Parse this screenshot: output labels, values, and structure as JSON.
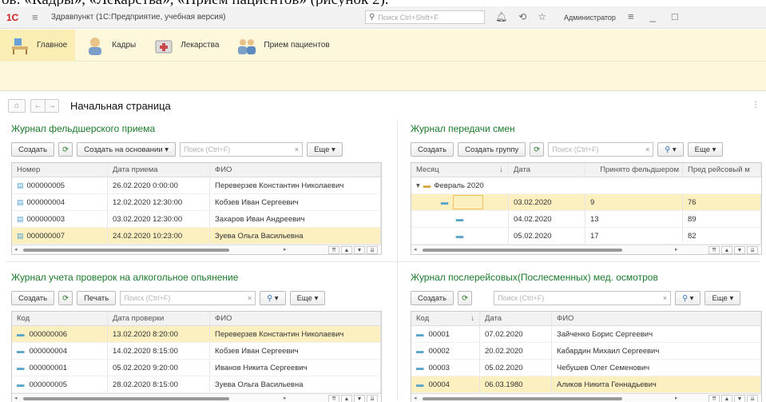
{
  "doc_caption": "ов: «Кадры», «Лекарства», «Прием пациентов» (рисунок 2).",
  "titlebar": {
    "logo": "1С",
    "title": "Здравпункт (1С:Предприятие, учебная версия)",
    "search_placeholder": "Поиск Ctrl+Shift+F",
    "user": "Администратор"
  },
  "sections": [
    {
      "label": "Главное",
      "icon": "desk-icon",
      "color": "#6aa0d8"
    },
    {
      "label": "Кадры",
      "icon": "staff-icon",
      "color": "#d9a35a"
    },
    {
      "label": "Лекарства",
      "icon": "medkit-icon",
      "color": "#c94a4a"
    },
    {
      "label": "Прием пациентов",
      "icon": "patients-icon",
      "color": "#7a9fc8"
    }
  ],
  "page": {
    "title": "Начальная страница"
  },
  "panels": {
    "reception": {
      "title": "Журнал фельдшерского приема",
      "create": "Создать",
      "create_based": "Создать на основании",
      "search_placeholder": "Поиск (Ctrl+F)",
      "more": "Еще",
      "columns": [
        "Номер",
        "Дата приема",
        "ФИО"
      ],
      "rows": [
        [
          "000000005",
          "26.02.2020 0:00:00",
          "Переверзев Константин Николаевич"
        ],
        [
          "000000004",
          "12.02.2020 12:30:00",
          "Кобзев Иван Сергеевич"
        ],
        [
          "000000003",
          "03.02.2020 12:30:00",
          "Захаров Иван Андреевич"
        ],
        [
          "000000007",
          "24.02.2020 10:23:00",
          "Зуева Ольга Васильевна"
        ]
      ],
      "selected_row": 3
    },
    "shifts": {
      "title": "Журнал передачи смен",
      "create": "Создать",
      "create_group": "Создать группу",
      "search_placeholder": "Поиск (Ctrl+F)",
      "more": "Еще",
      "columns": [
        "Месяц",
        "Дата",
        "Принято фельдшером",
        "Пред рейсовый м"
      ],
      "group": "Февраль 2020",
      "rows": [
        [
          "",
          "03.02.2020",
          "9",
          "76"
        ],
        [
          "",
          "04.02.2020",
          "13",
          "89"
        ],
        [
          "",
          "05.02.2020",
          "17",
          "82"
        ]
      ],
      "selected_row": 0
    },
    "alcohol": {
      "title": "Журнал учета проверок на алкогольное опьянение",
      "create": "Создать",
      "print": "Печать",
      "search_placeholder": "Поиск (Ctrl+F)",
      "more": "Еще",
      "columns": [
        "Код",
        "Дата проверки",
        "ФИО"
      ],
      "rows": [
        [
          "000000006",
          "13.02.2020 8:20:00",
          "Переверзев Константин Николаевич"
        ],
        [
          "000000004",
          "14.02.2020 8:15:00",
          "Кобзев Иван Сергеевич"
        ],
        [
          "000000001",
          "05.02.2020 9:20:00",
          "Иванов Никита Сергеевич"
        ],
        [
          "000000005",
          "28.02.2020 8:15:00",
          "Зуева Ольга Васильевна"
        ]
      ],
      "selected_row": 0
    },
    "postflight": {
      "title": "Журнал послерейсовых(Послесменных) мед. осмотров",
      "create": "Создать",
      "search_placeholder": "Поиск (Ctrl+F)",
      "more": "Еще",
      "columns": [
        "Код",
        "Дата",
        "ФИО"
      ],
      "rows": [
        [
          "00001",
          "07.02.2020",
          "Зайченко Борис Сергеевич"
        ],
        [
          "00002",
          "20.02.2020",
          "Кабардин Михаил Сергеевич"
        ],
        [
          "00003",
          "05.02.2020",
          "Чебушев Олег Семенович"
        ],
        [
          "00004",
          "06.03.1980",
          "Аликов Никита Геннадьевич"
        ]
      ],
      "selected_row": 3
    }
  }
}
